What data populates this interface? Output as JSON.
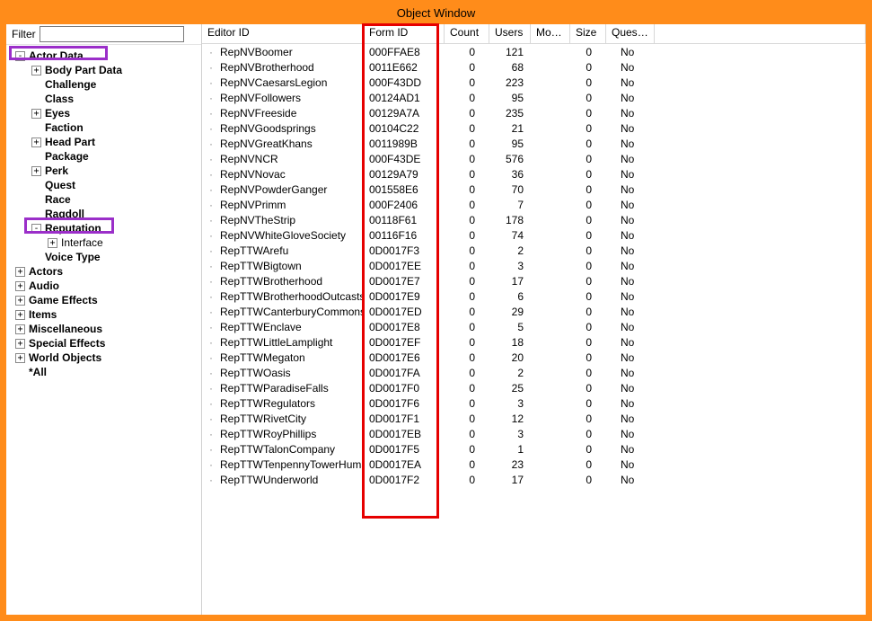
{
  "title": "Object Window",
  "filter": {
    "label": "Filter",
    "value": ""
  },
  "tree": [
    {
      "level": 1,
      "label": "Actor Data",
      "exp": "-",
      "bold": true
    },
    {
      "level": 2,
      "label": "Body Part Data",
      "exp": "+",
      "bold": true
    },
    {
      "level": 2,
      "label": "Challenge",
      "exp": "",
      "bold": true
    },
    {
      "level": 2,
      "label": "Class",
      "exp": "",
      "bold": true
    },
    {
      "level": 2,
      "label": "Eyes",
      "exp": "+",
      "bold": true
    },
    {
      "level": 2,
      "label": "Faction",
      "exp": "",
      "bold": true
    },
    {
      "level": 2,
      "label": "Head Part",
      "exp": "+",
      "bold": true
    },
    {
      "level": 2,
      "label": "Package",
      "exp": "",
      "bold": true
    },
    {
      "level": 2,
      "label": "Perk",
      "exp": "+",
      "bold": true
    },
    {
      "level": 2,
      "label": "Quest",
      "exp": "",
      "bold": true
    },
    {
      "level": 2,
      "label": "Race",
      "exp": "",
      "bold": true
    },
    {
      "level": 2,
      "label": "Ragdoll",
      "exp": "",
      "bold": true
    },
    {
      "level": 2,
      "label": "Reputation",
      "exp": "-",
      "bold": true
    },
    {
      "level": 3,
      "label": "Interface",
      "exp": "+",
      "bold": false
    },
    {
      "level": 2,
      "label": "Voice Type",
      "exp": "",
      "bold": true
    },
    {
      "level": 1,
      "label": "Actors",
      "exp": "+",
      "bold": true
    },
    {
      "level": 1,
      "label": "Audio",
      "exp": "+",
      "bold": true
    },
    {
      "level": 1,
      "label": "Game Effects",
      "exp": "+",
      "bold": true
    },
    {
      "level": 1,
      "label": "Items",
      "exp": "+",
      "bold": true
    },
    {
      "level": 1,
      "label": "Miscellaneous",
      "exp": "+",
      "bold": true
    },
    {
      "level": 1,
      "label": "Special Effects",
      "exp": "+",
      "bold": true
    },
    {
      "level": 1,
      "label": "World Objects",
      "exp": "+",
      "bold": true
    },
    {
      "level": 1,
      "label": "*All",
      "exp": "",
      "bold": true
    }
  ],
  "columns": {
    "editor": "Editor ID",
    "form": "Form ID",
    "count": "Count",
    "users": "Users",
    "model": "Model",
    "size": "Size",
    "quest": "Quest..."
  },
  "rows": [
    {
      "editor": "RepNVBoomer",
      "form": "000FFAE8",
      "count": 0,
      "users": 121,
      "model": "",
      "size": 0,
      "quest": "No"
    },
    {
      "editor": "RepNVBrotherhood",
      "form": "0011E662",
      "count": 0,
      "users": 68,
      "model": "",
      "size": 0,
      "quest": "No"
    },
    {
      "editor": "RepNVCaesarsLegion",
      "form": "000F43DD",
      "count": 0,
      "users": 223,
      "model": "",
      "size": 0,
      "quest": "No"
    },
    {
      "editor": "RepNVFollowers",
      "form": "00124AD1",
      "count": 0,
      "users": 95,
      "model": "",
      "size": 0,
      "quest": "No"
    },
    {
      "editor": "RepNVFreeside",
      "form": "00129A7A",
      "count": 0,
      "users": 235,
      "model": "",
      "size": 0,
      "quest": "No"
    },
    {
      "editor": "RepNVGoodsprings",
      "form": "00104C22",
      "count": 0,
      "users": 21,
      "model": "",
      "size": 0,
      "quest": "No"
    },
    {
      "editor": "RepNVGreatKhans",
      "form": "0011989B",
      "count": 0,
      "users": 95,
      "model": "",
      "size": 0,
      "quest": "No"
    },
    {
      "editor": "RepNVNCR",
      "form": "000F43DE",
      "count": 0,
      "users": 576,
      "model": "",
      "size": 0,
      "quest": "No"
    },
    {
      "editor": "RepNVNovac",
      "form": "00129A79",
      "count": 0,
      "users": 36,
      "model": "",
      "size": 0,
      "quest": "No"
    },
    {
      "editor": "RepNVPowderGanger",
      "form": "001558E6",
      "count": 0,
      "users": 70,
      "model": "",
      "size": 0,
      "quest": "No"
    },
    {
      "editor": "RepNVPrimm",
      "form": "000F2406",
      "count": 0,
      "users": 7,
      "model": "",
      "size": 0,
      "quest": "No"
    },
    {
      "editor": "RepNVTheStrip",
      "form": "00118F61",
      "count": 0,
      "users": 178,
      "model": "",
      "size": 0,
      "quest": "No"
    },
    {
      "editor": "RepNVWhiteGloveSociety",
      "form": "00116F16",
      "count": 0,
      "users": 74,
      "model": "",
      "size": 0,
      "quest": "No"
    },
    {
      "editor": "RepTTWArefu",
      "form": "0D0017F3",
      "count": 0,
      "users": 2,
      "model": "",
      "size": 0,
      "quest": "No"
    },
    {
      "editor": "RepTTWBigtown",
      "form": "0D0017EE",
      "count": 0,
      "users": 3,
      "model": "",
      "size": 0,
      "quest": "No"
    },
    {
      "editor": "RepTTWBrotherhood",
      "form": "0D0017E7",
      "count": 0,
      "users": 17,
      "model": "",
      "size": 0,
      "quest": "No"
    },
    {
      "editor": "RepTTWBrotherhoodOutcasts",
      "form": "0D0017E9",
      "count": 0,
      "users": 6,
      "model": "",
      "size": 0,
      "quest": "No"
    },
    {
      "editor": "RepTTWCanterburyCommons",
      "form": "0D0017ED",
      "count": 0,
      "users": 29,
      "model": "",
      "size": 0,
      "quest": "No"
    },
    {
      "editor": "RepTTWEnclave",
      "form": "0D0017E8",
      "count": 0,
      "users": 5,
      "model": "",
      "size": 0,
      "quest": "No"
    },
    {
      "editor": "RepTTWLittleLamplight",
      "form": "0D0017EF",
      "count": 0,
      "users": 18,
      "model": "",
      "size": 0,
      "quest": "No"
    },
    {
      "editor": "RepTTWMegaton",
      "form": "0D0017E6",
      "count": 0,
      "users": 20,
      "model": "",
      "size": 0,
      "quest": "No"
    },
    {
      "editor": "RepTTWOasis",
      "form": "0D0017FA",
      "count": 0,
      "users": 2,
      "model": "",
      "size": 0,
      "quest": "No"
    },
    {
      "editor": "RepTTWParadiseFalls",
      "form": "0D0017F0",
      "count": 0,
      "users": 25,
      "model": "",
      "size": 0,
      "quest": "No"
    },
    {
      "editor": "RepTTWRegulators",
      "form": "0D0017F6",
      "count": 0,
      "users": 3,
      "model": "",
      "size": 0,
      "quest": "No"
    },
    {
      "editor": "RepTTWRivetCity",
      "form": "0D0017F1",
      "count": 0,
      "users": 12,
      "model": "",
      "size": 0,
      "quest": "No"
    },
    {
      "editor": "RepTTWRoyPhillips",
      "form": "0D0017EB",
      "count": 0,
      "users": 3,
      "model": "",
      "size": 0,
      "quest": "No"
    },
    {
      "editor": "RepTTWTalonCompany",
      "form": "0D0017F5",
      "count": 0,
      "users": 1,
      "model": "",
      "size": 0,
      "quest": "No"
    },
    {
      "editor": "RepTTWTenpennyTowerHuman",
      "form": "0D0017EA",
      "count": 0,
      "users": 23,
      "model": "",
      "size": 0,
      "quest": "No"
    },
    {
      "editor": "RepTTWUnderworld",
      "form": "0D0017F2",
      "count": 0,
      "users": 17,
      "model": "",
      "size": 0,
      "quest": "No"
    }
  ]
}
